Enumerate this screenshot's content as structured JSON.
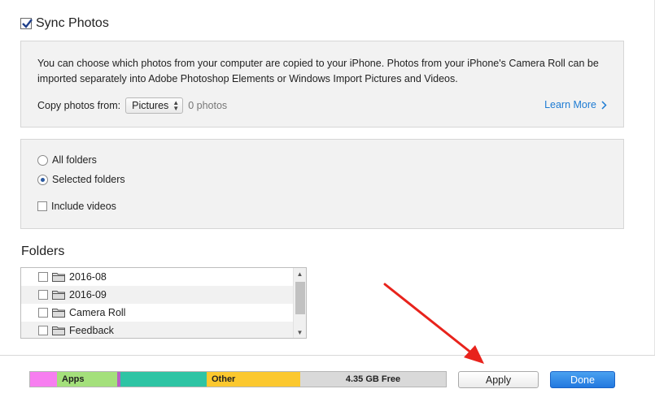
{
  "sync": {
    "checked": true,
    "title": "Sync Photos"
  },
  "info": {
    "text": "You can choose which photos from your computer are copied to your iPhone. Photos from your iPhone's Camera Roll can be imported separately into Adobe Photoshop Elements or Windows Import Pictures and Videos.",
    "copy_from_label": "Copy photos from:",
    "copy_from_value": "Pictures",
    "photo_count": "0 photos",
    "learn_more": "Learn More"
  },
  "options": {
    "all_folders": "All folders",
    "selected_folders": "Selected folders",
    "selected_option": "selected_folders",
    "include_videos": "Include videos"
  },
  "folders": {
    "title": "Folders",
    "items": [
      {
        "name": "2016-08"
      },
      {
        "name": "2016-09"
      },
      {
        "name": "Camera Roll"
      },
      {
        "name": "Feedback"
      }
    ]
  },
  "storage": {
    "segments": [
      {
        "name": "",
        "color": "#f77ef0",
        "fraction": 0.065
      },
      {
        "name": "Apps",
        "color": "#a4e07b",
        "fraction": 0.145
      },
      {
        "name": "",
        "color": "#b85fc4",
        "fraction": 0.008
      },
      {
        "name": "",
        "color": "#2ec4a4",
        "fraction": 0.207
      },
      {
        "name": "Other",
        "color": "#fbc82f",
        "fraction": 0.225
      },
      {
        "name": "4.35 GB Free",
        "color": "#d9d9d9",
        "fraction": 0.35
      }
    ]
  },
  "buttons": {
    "apply": "Apply",
    "done": "Done"
  },
  "colors": {
    "link": "#1d7bd3",
    "done_button": "#2278df",
    "annotation_arrow": "#e8231c"
  },
  "icons": {
    "learn_more": "chevron-right-icon",
    "folder": "folder-icon",
    "annotation": "red-arrow-pointing-to-apply"
  }
}
